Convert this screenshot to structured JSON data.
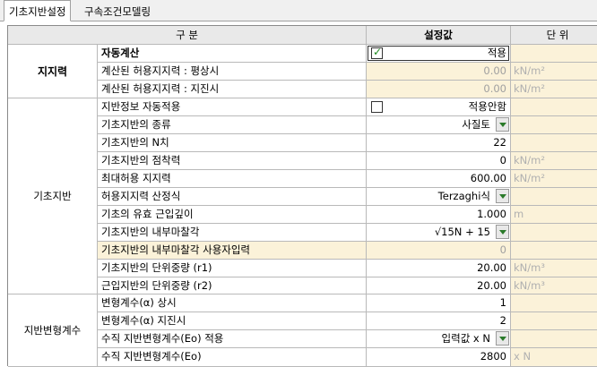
{
  "tabs": [
    {
      "label": "기초지반설정",
      "active": true
    },
    {
      "label": "구속조건모델링",
      "active": false
    }
  ],
  "header": {
    "col_category": "구 분",
    "col_value": "설정값",
    "col_unit": "단 위"
  },
  "groups": [
    {
      "label": "지지력"
    },
    {
      "label": "기초지반"
    },
    {
      "label": "지반변형계수"
    }
  ],
  "rows": [
    {
      "item": "자동계산",
      "value": "적용",
      "unit": "",
      "checked": true
    },
    {
      "item": "계산된 허용지지력 : 평상시",
      "value": "0.00",
      "unit": "kN/m²"
    },
    {
      "item": "계산된 허용지지력 : 지진시",
      "value": "0.00",
      "unit": "kN/m²"
    },
    {
      "item": "지반정보 자동적용",
      "value": "적용안함",
      "unit": "",
      "checked": false
    },
    {
      "item": "기초지반의 종류",
      "value": "사질토",
      "unit": ""
    },
    {
      "item": "기초지반의 N치",
      "value": "22",
      "unit": ""
    },
    {
      "item": "기초지반의 점착력",
      "value": "0",
      "unit": "kN/m²"
    },
    {
      "item": "최대허용 지지력",
      "value": "600.00",
      "unit": "kN/m²"
    },
    {
      "item": "허용지지력 산정식",
      "value": "Terzaghi식",
      "unit": ""
    },
    {
      "item": "기초의 유효 근입깊이",
      "value": "1.000",
      "unit": "m"
    },
    {
      "item": "기초지반의 내부마찰각",
      "value": "√15N + 15",
      "unit": ""
    },
    {
      "item": "기초지반의 내부마찰각 사용자입력",
      "value": "0",
      "unit": ""
    },
    {
      "item": "기초지반의 단위중량 (r1)",
      "value": "20.00",
      "unit": "kN/m³"
    },
    {
      "item": "근입지반의 단위중량 (r2)",
      "value": "20.00",
      "unit": "kN/m³"
    },
    {
      "item": "변형계수(α) 상시",
      "value": "1",
      "unit": ""
    },
    {
      "item": "변형계수(α) 지진시",
      "value": "2",
      "unit": ""
    },
    {
      "item": "수직 지반변형계수(Eo) 적용",
      "value": "입력값 x N",
      "unit": ""
    },
    {
      "item": "수직 지반변형계수(Eo)",
      "value": "2800",
      "unit": "x N"
    }
  ]
}
